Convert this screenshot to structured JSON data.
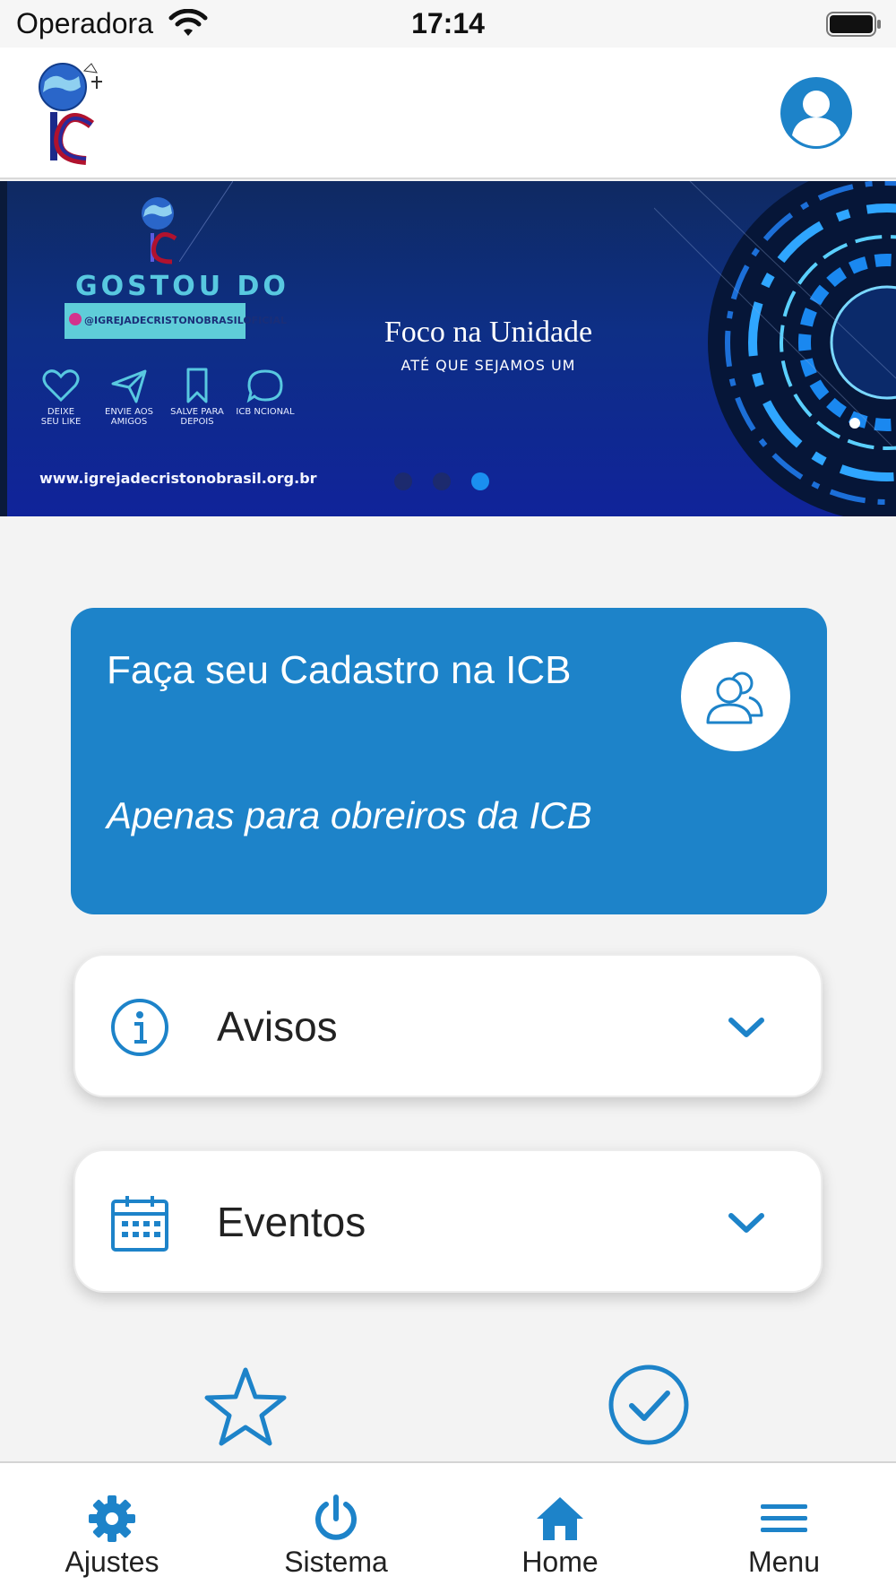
{
  "status_bar": {
    "carrier": "Operadora",
    "time": "17:14"
  },
  "header": {
    "logo_icon": "church-globe-logo",
    "profile_icon": "user-circle-icon"
  },
  "banner": {
    "title": "GOSTOU DO",
    "handle": "@IGREJADECRISTONOBRASILOFICIAL",
    "actions": [
      {
        "icon": "heart-icon",
        "label": "DEIXE\nSEU LIKE"
      },
      {
        "icon": "send-icon",
        "label": "ENVIE AOS\nAMIGOS"
      },
      {
        "icon": "bookmark-icon",
        "label": "SALVE PARA\nDEPOIS"
      },
      {
        "icon": "chat-bubble-icon",
        "label": "ICB NCIONAL"
      }
    ],
    "url": "www.igrejadecristonobrasil.org.br",
    "focus_title": "Foco na Unidade",
    "focus_subtitle": "ATÉ QUE SEJAMOS UM",
    "slides_count": 3,
    "active_slide": 3
  },
  "register_card": {
    "title": "Faça seu Cadastro na ICB",
    "subtitle": "Apenas para obreiros da ICB",
    "icon": "users-group-icon"
  },
  "sections": [
    {
      "label": "Avisos",
      "icon": "info-icon"
    },
    {
      "label": "Eventos",
      "icon": "calendar-icon"
    }
  ],
  "tabs": [
    {
      "label": "Ajustes",
      "icon": "gear-icon"
    },
    {
      "label": "Sistema",
      "icon": "power-icon"
    },
    {
      "label": "Home",
      "icon": "home-icon"
    },
    {
      "label": "Menu",
      "icon": "hamburger-menu-icon"
    }
  ],
  "colors": {
    "accent": "#1d83c9",
    "banner_bg": "#0e2f86",
    "active_dot": "#1a8ff0",
    "inactive_dot": "#1c2a6e"
  }
}
